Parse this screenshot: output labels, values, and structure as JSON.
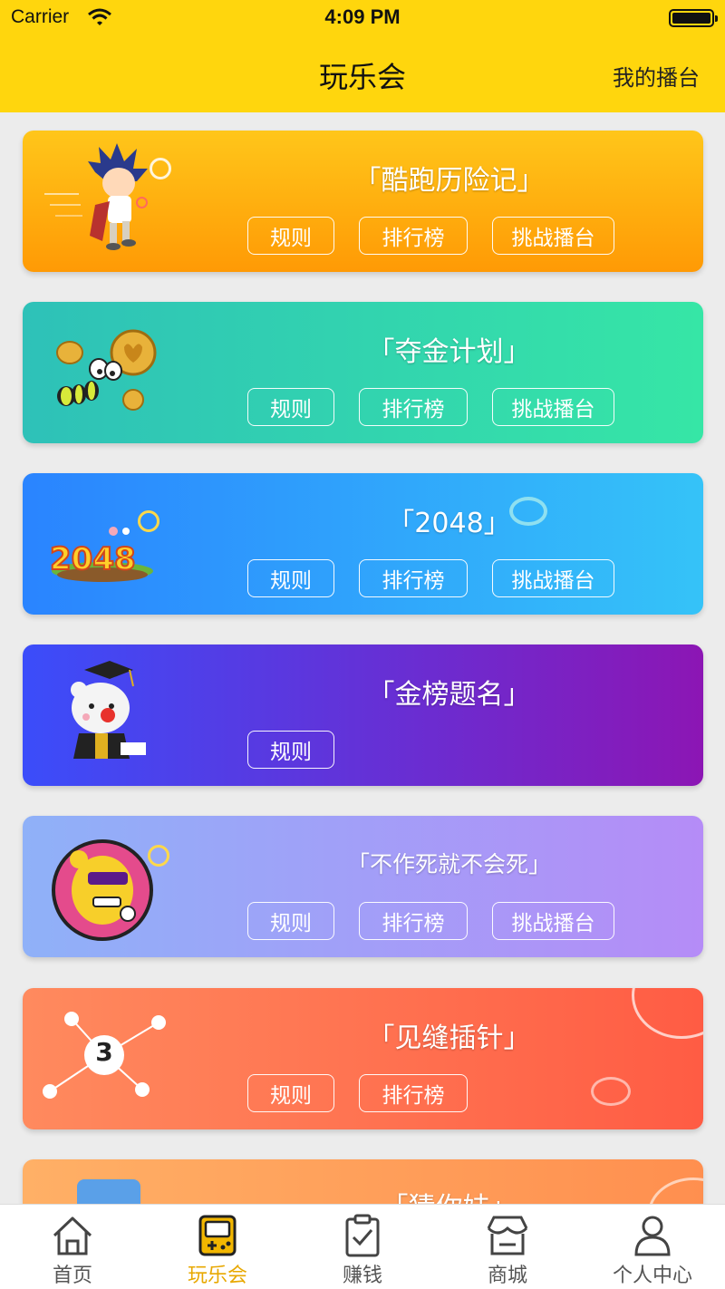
{
  "status_bar": {
    "carrier": "Carrier",
    "time": "4:09 PM"
  },
  "nav": {
    "title": "玩乐会",
    "right_link": "我的播台"
  },
  "games": [
    {
      "title": "「酷跑历险记」",
      "rules": "规则",
      "ranking": "排行榜",
      "challenge": "挑战播台",
      "colors": [
        "#ffc61a",
        "#ff9a05"
      ]
    },
    {
      "title": "「夺金计划」",
      "rules": "规则",
      "ranking": "排行榜",
      "challenge": "挑战播台",
      "colors": [
        "#2ec1b8",
        "#36e6a6"
      ]
    },
    {
      "title": "「2048」",
      "rules": "规则",
      "ranking": "排行榜",
      "challenge": "挑战播台",
      "colors": [
        "#2a84ff",
        "#35c3f8"
      ]
    },
    {
      "title": "「金榜题名」",
      "rules": "规则",
      "colors": [
        "#3b4dfa",
        "#8c16b4"
      ]
    },
    {
      "title": "「不作死就不会死」",
      "rules": "规则",
      "ranking": "排行榜",
      "challenge": "挑战播台",
      "colors": [
        "#8fb1f8",
        "#b58cf7"
      ]
    },
    {
      "title": "「见缝插针」",
      "rules": "规则",
      "ranking": "排行榜",
      "number": "3",
      "colors": [
        "#ff8a5e",
        "#ff5c44"
      ]
    },
    {
      "title": "「猜你妹」",
      "colors": [
        "#ffb066",
        "#ff8f4f"
      ]
    }
  ],
  "tabbar": [
    {
      "label": "首页",
      "icon": "home-icon"
    },
    {
      "label": "玩乐会",
      "icon": "gamepad-icon",
      "active": true
    },
    {
      "label": "赚钱",
      "icon": "clipboard-check-icon"
    },
    {
      "label": "商城",
      "icon": "store-icon"
    },
    {
      "label": "个人中心",
      "icon": "person-icon"
    }
  ],
  "colors": {
    "accent": "#ffd60d",
    "tab_active": "#e8a800",
    "background": "#ececec"
  }
}
